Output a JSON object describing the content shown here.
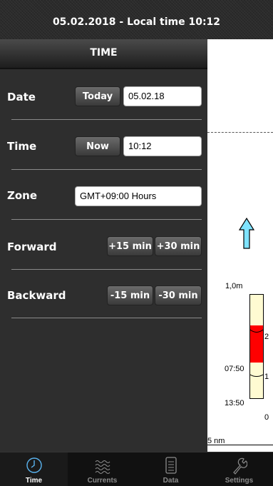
{
  "header": {
    "title": "05.02.2018 - Local time 10:12"
  },
  "panel": {
    "title": "TIME",
    "date": {
      "label": "Date",
      "today_button": "Today",
      "value": "05.02.18"
    },
    "time": {
      "label": "Time",
      "now_button": "Now",
      "value": "10:12"
    },
    "zone": {
      "label": "Zone",
      "value": "GMT+09:00 Hours"
    },
    "forward": {
      "label": "Forward",
      "plus15": "+15 min",
      "plus30": "+30 min"
    },
    "backward": {
      "label": "Backward",
      "minus15": "-15 min",
      "minus30": "-30 min"
    }
  },
  "map": {
    "gauge_max": "1,0m",
    "tick_2": "2",
    "tick_1": "1",
    "tick_0": "0",
    "time_high": "07:50",
    "time_low": "13:50",
    "scale_label": "5 nm",
    "arrow_color": "#7fe3ff",
    "fill_color": "#ff0000"
  },
  "tabs": [
    {
      "label": "Time",
      "icon": "clock-icon",
      "active": true
    },
    {
      "label": "Currents",
      "icon": "waves-icon",
      "active": false
    },
    {
      "label": "Data",
      "icon": "document-icon",
      "active": false
    },
    {
      "label": "Settings",
      "icon": "wrench-icon",
      "active": false
    }
  ]
}
